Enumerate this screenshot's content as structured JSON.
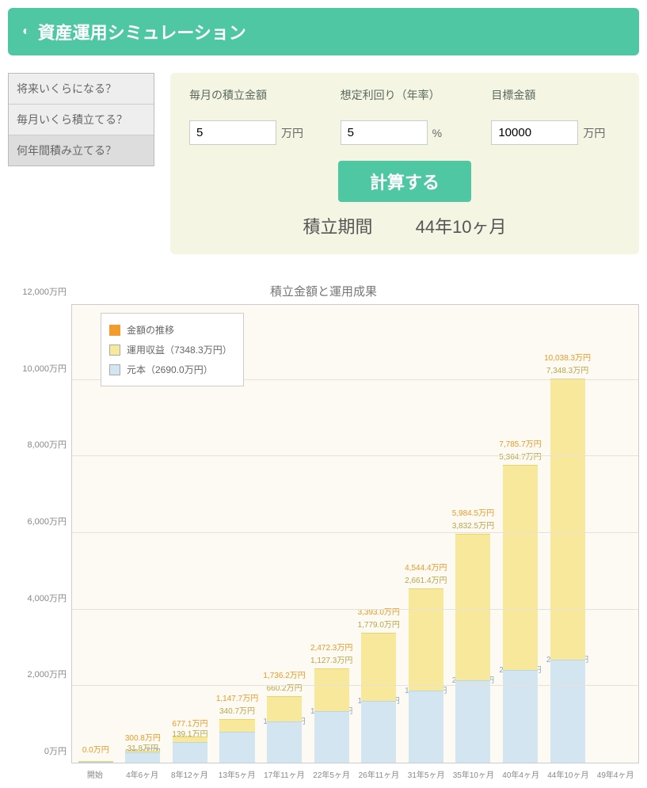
{
  "header": {
    "title": "資産運用シミュレーション"
  },
  "tabs": [
    {
      "label": "将来いくらになる？",
      "active": false
    },
    {
      "label": "毎月いくら積立てる？",
      "active": false
    },
    {
      "label": "何年間積み立てる？",
      "active": true
    }
  ],
  "form": {
    "fields": [
      {
        "label": "毎月の積立金額",
        "value": "5",
        "unit": "万円"
      },
      {
        "label": "想定利回り（年率）",
        "value": "5",
        "unit": "%"
      },
      {
        "label": "目標金額",
        "value": "10000",
        "unit": "万円"
      }
    ],
    "button": "計算する",
    "result_label": "積立期間",
    "result_value": "44年10ヶ月"
  },
  "legend": {
    "trend": "金額の推移",
    "gains": "運用収益（7348.3万円）",
    "principal": "元本（2690.0万円）"
  },
  "chart_data": {
    "type": "bar",
    "title": "積立金額と運用成果",
    "ylabel": "",
    "ylim": [
      0,
      12000
    ],
    "y_ticks": [
      0,
      2000,
      4000,
      6000,
      8000,
      10000,
      12000
    ],
    "y_tick_labels": [
      "0万円",
      "2,000万円",
      "4,000万円",
      "6,000万円",
      "8,000万円",
      "10,000万円",
      "12,000万円"
    ],
    "categories": [
      "開始",
      "4年6ヶ月",
      "8年12ヶ月",
      "13年5ヶ月",
      "17年11ヶ月",
      "22年5ヶ月",
      "26年11ヶ月",
      "31年5ヶ月",
      "35年10ヶ月",
      "40年4ヶ月",
      "44年10ヶ月",
      "49年4ヶ月"
    ],
    "series": [
      {
        "name": "元本",
        "values": [
          0,
          269.0,
          538.0,
          807.0,
          1076.0,
          1345.0,
          1614.0,
          1883.0,
          2152.0,
          2421.0,
          2690.0,
          null
        ]
      },
      {
        "name": "運用収益",
        "values": [
          0,
          31.8,
          139.1,
          340.7,
          660.2,
          1127.3,
          1779.0,
          2661.4,
          3832.5,
          5364.7,
          7348.3,
          null
        ]
      }
    ],
    "totals": [
      0.0,
      300.8,
      677.1,
      1147.7,
      1736.2,
      2472.3,
      3393.0,
      4544.4,
      5984.5,
      7785.7,
      10038.3,
      null
    ],
    "total_labels": [
      "0.0万円",
      "300.8万円",
      "677.1万円",
      "1,147.7万円",
      "1,736.2万円",
      "2,472.3万円",
      "3,393.0万円",
      "4,544.4万円",
      "5,984.5万円",
      "7,785.7万円",
      "10,038.3万円",
      ""
    ],
    "gain_labels": [
      "",
      "31.8万円",
      "139.1万円",
      "340.7万円",
      "660.2万円",
      "1,127.3万円",
      "1,779.0万円",
      "2,661.4万円",
      "3,832.5万円",
      "5,364.7万円",
      "7,348.3万円",
      ""
    ],
    "principal_labels": [
      "",
      "269.0万円",
      "538.0万円",
      "807.0万円",
      "1,076.0万円",
      "1,345.0万円",
      "1,614.0万円",
      "1,883.0万円",
      "2,152.0万円",
      "2,421.0万円",
      "2,690.0万円",
      ""
    ]
  }
}
